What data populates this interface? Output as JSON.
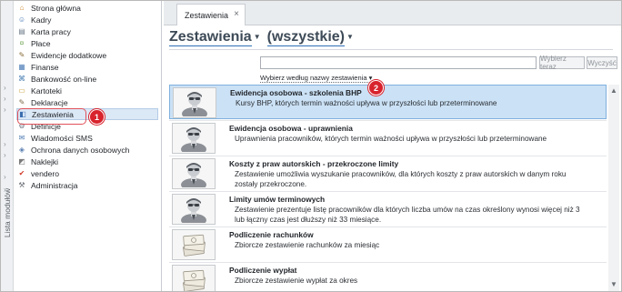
{
  "sidebar": {
    "vertical_label": "Lista modułów",
    "items": [
      {
        "label": "Strona główna",
        "icon": "home-icon"
      },
      {
        "label": "Kadry",
        "icon": "people-icon"
      },
      {
        "label": "Karta pracy",
        "icon": "card-icon"
      },
      {
        "label": "Płace",
        "icon": "money-icon"
      },
      {
        "label": "Ewidencje dodatkowe",
        "icon": "pencil-icon"
      },
      {
        "label": "Finanse",
        "icon": "finance-icon"
      },
      {
        "label": "Bankowość on-line",
        "icon": "bank-icon"
      },
      {
        "label": "Kartoteki",
        "icon": "folder-icon"
      },
      {
        "label": "Deklaracje",
        "icon": "declaration-icon"
      },
      {
        "label": "Zestawienia",
        "icon": "report-icon",
        "active": true
      },
      {
        "label": "Definicje",
        "icon": "settings-icon"
      },
      {
        "label": "Wiadomości SMS",
        "icon": "sms-icon"
      },
      {
        "label": "Ochrona danych osobowych",
        "icon": "shield-icon"
      },
      {
        "label": "Naklejki",
        "icon": "sticker-icon"
      },
      {
        "label": "vendero",
        "icon": "vendero-icon"
      },
      {
        "label": "Administracja",
        "icon": "admin-icon"
      }
    ]
  },
  "tab": {
    "label": "Zestawienia",
    "close": "×"
  },
  "heading": {
    "title": "Zestawienia",
    "filter": "(wszystkie)"
  },
  "search": {
    "placeholder": "",
    "search_label": "Wybierz teraz",
    "clear_label": "Wyczyść"
  },
  "name_filter_label": "Wybierz według nazwy zestawienia",
  "annotations": {
    "badge1": "1",
    "badge2": "2"
  },
  "rows": [
    {
      "title": "Ewidencja osobowa - szkolenia BHP",
      "desc": "Kursy BHP, których termin ważności upływa w przyszłości lub przeterminowane",
      "icon": "person-icon",
      "selected": true
    },
    {
      "title": "Ewidencja osobowa - uprawnienia",
      "desc": "Uprawnienia pracowników, których termin ważności upływa w przyszłości lub przeterminowane",
      "icon": "person-icon"
    },
    {
      "title": "Koszty z praw autorskich - przekroczone limity",
      "desc": "Zestawienie umożliwia wyszukanie pracowników, dla których koszty z praw autorskich w danym roku zostały przekroczone.",
      "icon": "person-icon"
    },
    {
      "title": "Limity umów terminowych",
      "desc": "Zestawienie prezentuje listę pracowników dla których liczba umów na czas określony wynosi więcej niż 3 lub łączny czas jest dłuższy niż 33 miesiące.",
      "icon": "person-icon"
    },
    {
      "title": "Podliczenie rachunków",
      "desc": "Zbiorcze zestawienie rachunków za miesiąc",
      "icon": "money-stack-icon"
    },
    {
      "title": "Podliczenie wypłat",
      "desc": "Zbiorcze zestawienie wypłat za okres",
      "icon": "money-stack-icon"
    }
  ],
  "colors": {
    "accent": "#2f6fb5",
    "selection": "#cbe1f5",
    "callout": "#d8232d"
  }
}
